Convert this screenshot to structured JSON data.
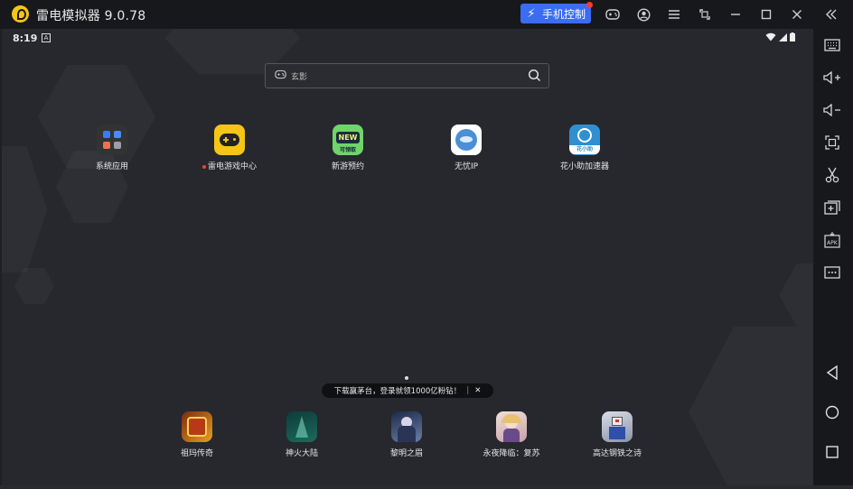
{
  "window": {
    "title": "雷电模拟器 9.0.78",
    "phone_control_label": "手机控制",
    "icons": [
      "gamepad-icon",
      "account-icon",
      "menu-icon",
      "restore-window-icon",
      "minimize-icon",
      "maximize-icon",
      "close-icon",
      "collapse-sidebar-icon"
    ]
  },
  "status_bar": {
    "time": "8:19",
    "notification_glyph": "A"
  },
  "search": {
    "text": "玄影"
  },
  "desktop_apps": [
    {
      "label": "系统应用",
      "icon": "system-apps-icon",
      "badge": false
    },
    {
      "label": "雷电游戏中心",
      "icon": "game-center-icon",
      "badge": true
    },
    {
      "label": "新游预约",
      "icon": "new-game-icon",
      "icon_text": "NEW",
      "icon_sub": "可领取"
    },
    {
      "label": "无忧IP",
      "icon": "wuyou-ip-icon"
    },
    {
      "label": "花小助加速器",
      "icon": "accelerator-icon",
      "icon_sub": "花小助"
    }
  ],
  "toast": {
    "text": "下载赢茅台，登录就领1000亿粉钻！",
    "close": "✕"
  },
  "dock_apps": [
    {
      "label": "祖玛传奇",
      "icon": "zuma-legend-icon"
    },
    {
      "label": "神火大陆",
      "icon": "shenhuo-icon"
    },
    {
      "label": "黎明之眉",
      "icon": "dawn-icon"
    },
    {
      "label": "永夜降临：复苏",
      "icon": "eternal-night-icon"
    },
    {
      "label": "高达钢铁之诗",
      "icon": "gundam-icon"
    }
  ],
  "sidebar": {
    "apk_label": "APK",
    "icons": [
      "keyboard-icon",
      "volume-up-icon",
      "volume-down-icon",
      "screenshot-icon",
      "scissors-icon",
      "add-window-icon",
      "apk-install-icon",
      "more-icon",
      "back-icon",
      "home-icon",
      "recents-icon"
    ]
  },
  "colors": {
    "accent": "#3b6cf4",
    "logo": "#f5c518",
    "background": "#26282d",
    "chrome": "#17181b"
  }
}
